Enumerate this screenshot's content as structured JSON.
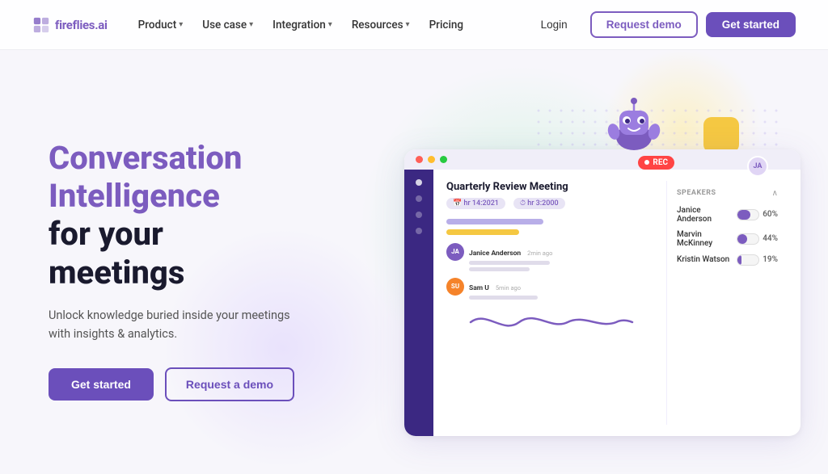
{
  "brand": {
    "name": "fireflies.ai",
    "logo_icon": "🟪"
  },
  "nav": {
    "links": [
      {
        "label": "Product",
        "has_dropdown": true
      },
      {
        "label": "Use case",
        "has_dropdown": true
      },
      {
        "label": "Integration",
        "has_dropdown": true
      },
      {
        "label": "Resources",
        "has_dropdown": true
      },
      {
        "label": "Pricing",
        "has_dropdown": false
      }
    ],
    "login_label": "Login",
    "request_demo_label": "Request demo",
    "get_started_label": "Get started"
  },
  "hero": {
    "title_line1": "Conversation",
    "title_line2": "Intelligence",
    "title_line3": "for your",
    "title_line4": "meetings",
    "subtitle": "Unlock knowledge buried inside your meetings with insights & analytics.",
    "cta_primary": "Get started",
    "cta_secondary": "Request a demo"
  },
  "dashboard": {
    "meeting_title": "Quarterly Review Meeting",
    "rec_label": "REC",
    "meta": [
      "hr 14:2021",
      "hr 3:2000"
    ],
    "speakers_header": "SPEAKERS",
    "speakers": [
      {
        "name": "Janice Anderson",
        "pct": "60%",
        "fill": 60
      },
      {
        "name": "Marvin McKinney",
        "pct": "44%",
        "fill": 44
      },
      {
        "name": "Kristin Watson",
        "pct": "19%",
        "fill": 19
      }
    ],
    "transcript_items": [
      {
        "initials": "JA",
        "name": "Janice Anderson",
        "time": "2min ago"
      },
      {
        "initials": "SU",
        "name": "Sam U",
        "time": "5min ago"
      }
    ]
  },
  "colors": {
    "brand_purple": "#6b4fbb",
    "hero_title_purple": "#7c5cbf",
    "hero_title_dark": "#1a1a2e",
    "rec_red": "#ff4444"
  }
}
